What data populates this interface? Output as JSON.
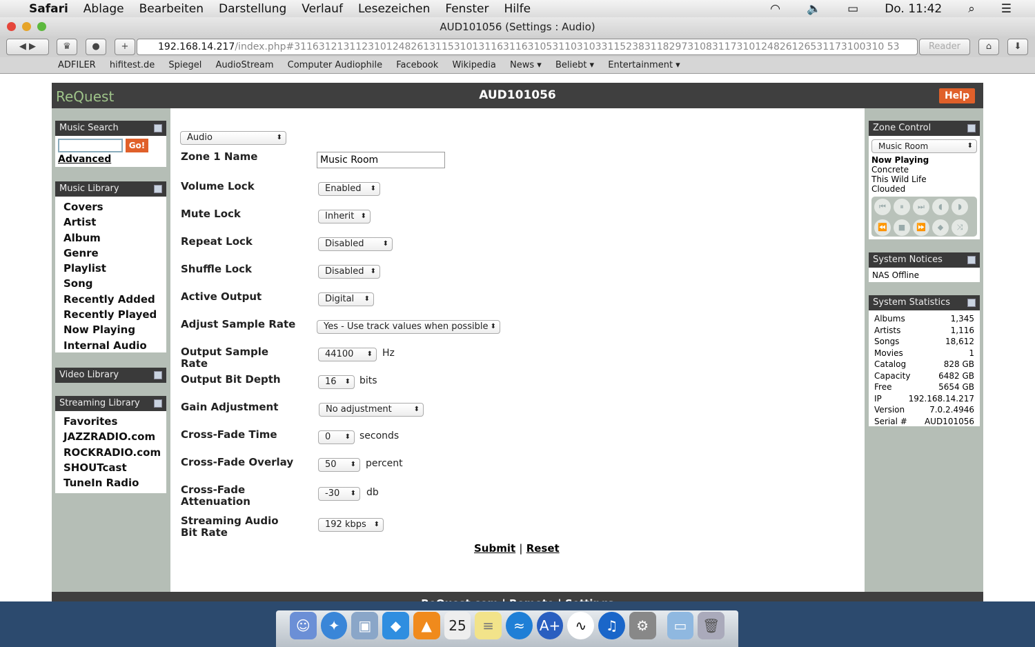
{
  "menubar": {
    "app": "Safari",
    "items": [
      "Ablage",
      "Bearbeiten",
      "Darstellung",
      "Verlauf",
      "Lesezeichen",
      "Fenster",
      "Hilfe"
    ],
    "clock": "Do. 11:42"
  },
  "window": {
    "title": "AUD101056 (Settings : Audio)"
  },
  "toolbar": {
    "url_host": "192.168.14.217",
    "url_rest": "/index.php#311631213112310124826131153101311631163105311031033115238311829731083117310124826126531173100310 53",
    "reader": "Reader"
  },
  "bookmarks": [
    "ADFILER",
    "hifitest.de",
    "Spiegel",
    "AudioStream",
    "Computer Audiophile",
    "Facebook",
    "Wikipedia",
    "News ▾",
    "Beliebt ▾",
    "Entertainment ▾"
  ],
  "header": {
    "logo": "ReQuest",
    "title": "AUD101056",
    "help": "Help"
  },
  "left": {
    "search": {
      "title": "Music Search",
      "go": "Go!",
      "advanced": "Advanced",
      "value": ""
    },
    "library": {
      "title": "Music Library",
      "items": [
        "Covers",
        "Artist",
        "Album",
        "Genre",
        "Playlist",
        "Song",
        "Recently Added",
        "Recently Played",
        "Now Playing",
        "Internal Audio"
      ]
    },
    "video": {
      "title": "Video Library"
    },
    "streaming": {
      "title": "Streaming Library",
      "items": [
        "Favorites",
        "JAZZRADIO.com",
        "ROCKRADIO.com",
        "SHOUTcast",
        "TuneIn Radio"
      ]
    }
  },
  "form": {
    "section": "Audio",
    "zone_name_label": "Zone 1 Name",
    "zone_name_value": "Music Room",
    "fields": [
      {
        "label": "Volume Lock",
        "value": "Enabled",
        "unit": ""
      },
      {
        "label": "Mute Lock",
        "value": "Inherit",
        "unit": ""
      },
      {
        "label": "Repeat Lock",
        "value": "Disabled",
        "unit": ""
      },
      {
        "label": "Shuffle Lock",
        "value": "Disabled",
        "unit": ""
      },
      {
        "label": "Active Output",
        "value": "Digital",
        "unit": ""
      },
      {
        "label": "Adjust Sample Rate",
        "value": "Yes - Use track values when possible",
        "unit": ""
      },
      {
        "label": "Output Sample Rate",
        "value": "44100",
        "unit": "Hz"
      },
      {
        "label": "Output Bit Depth",
        "value": "16",
        "unit": "bits"
      },
      {
        "label": "Gain Adjustment",
        "value": "No adjustment",
        "unit": ""
      },
      {
        "label": "Cross-Fade Time",
        "value": "0",
        "unit": "seconds"
      },
      {
        "label": "Cross-Fade Overlay",
        "value": "50",
        "unit": "percent"
      },
      {
        "label": "Cross-Fade Attenuation",
        "value": "-30",
        "unit": "db"
      },
      {
        "label": "Streaming Audio Bit Rate",
        "value": "192 kbps",
        "unit": ""
      }
    ],
    "submit": "Submit",
    "sep": "|",
    "reset": "Reset"
  },
  "right": {
    "zone": {
      "title": "Zone Control",
      "zone": "Music Room",
      "now_playing": "Now Playing",
      "track": "Concrete",
      "artist": "This Wild Life",
      "album": "Clouded"
    },
    "notices": {
      "title": "System Notices",
      "text": "NAS Offline"
    },
    "stats": {
      "title": "System Statistics",
      "rows": [
        [
          "Albums",
          "1,345"
        ],
        [
          "Artists",
          "1,116"
        ],
        [
          "Songs",
          "18,612"
        ],
        [
          "Movies",
          "1"
        ],
        [
          "Catalog",
          "828 GB"
        ],
        [
          "Capacity",
          "6482 GB"
        ],
        [
          "Free",
          "5654 GB"
        ],
        [
          "IP",
          "192.168.14.217"
        ],
        [
          "Version",
          "7.0.2.4946"
        ],
        [
          "Serial #",
          "AUD101056"
        ]
      ]
    }
  },
  "footer": "ReQuest.com | Remote | Settings"
}
